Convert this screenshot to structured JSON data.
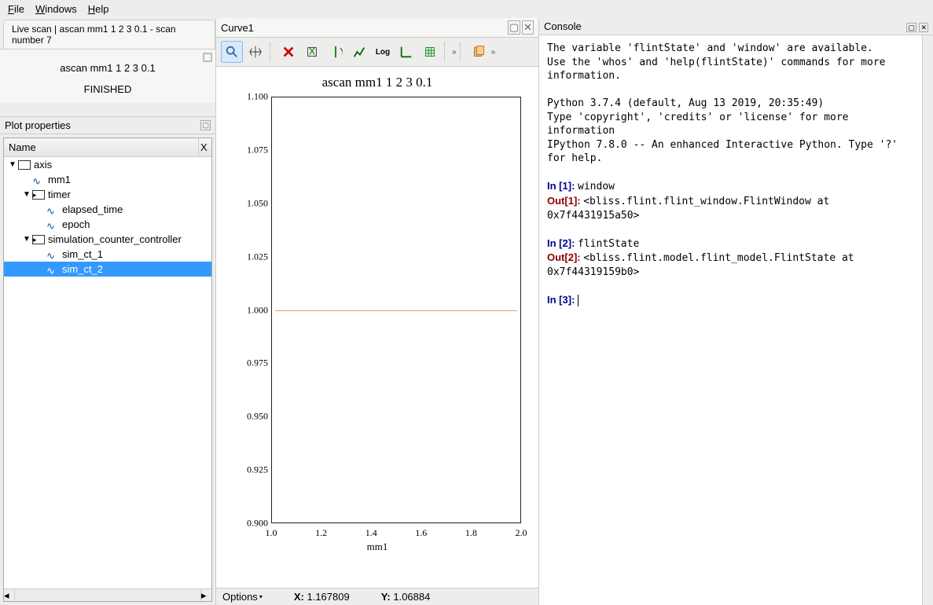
{
  "menu": {
    "file": "File",
    "windows": "Windows",
    "help": "Help"
  },
  "tab_title": "Live scan | ascan mm1 1 2 3 0.1 - scan number 7",
  "scan": {
    "title": "ascan mm1 1 2 3 0.1",
    "status": "FINISHED"
  },
  "plot_props_label": "Plot properties",
  "tree_header": {
    "name": "Name",
    "x": "X"
  },
  "tree": {
    "axis": "axis",
    "mm1": "mm1",
    "timer": "timer",
    "elapsed_time": "elapsed_time",
    "epoch": "epoch",
    "scc": "simulation_counter_controller",
    "sim1": "sim_ct_1",
    "sim2": "sim_ct_2"
  },
  "curve_title": "Curve1",
  "chart_data": {
    "type": "line",
    "title": "ascan mm1 1 2 3 0.1",
    "xlabel": "mm1",
    "ylabel": "",
    "xlim": [
      1.0,
      2.0
    ],
    "ylim": [
      0.9,
      1.1
    ],
    "x": [
      1.0,
      2.0
    ],
    "series": [
      {
        "name": "sim_ct_2",
        "values": [
          1.0,
          1.0
        ],
        "color": "#d4a84a"
      }
    ],
    "yticks": [
      "0.900",
      "0.925",
      "0.950",
      "0.975",
      "1.000",
      "1.025",
      "1.050",
      "1.075",
      "1.100"
    ],
    "xticks": [
      "1.0",
      "1.2",
      "1.4",
      "1.6",
      "1.8",
      "2.0"
    ]
  },
  "status": {
    "options": "Options",
    "x_label": "X:",
    "x_val": "1.167809",
    "y_label": "Y:",
    "y_val": "1.06884"
  },
  "console": {
    "title": "Console",
    "intro1": "The variable 'flintState' and 'window' are available.",
    "intro2": "Use the 'whos' and 'help(flintState)' commands for more information.",
    "intro3": "",
    "py1": "Python 3.7.4 (default, Aug 13 2019, 20:35:49)",
    "py2": "Type 'copyright', 'credits' or 'license' for more information",
    "py3": "IPython 7.8.0 -- An enhanced Interactive Python. Type '?' for help.",
    "in1_cmd": "window",
    "out1": "<bliss.flint.flint_window.FlintWindow at 0x7f4431915a50>",
    "in2_cmd": "flintState",
    "out2": "<bliss.flint.model.flint_model.FlintState at 0x7f44319159b0>"
  }
}
